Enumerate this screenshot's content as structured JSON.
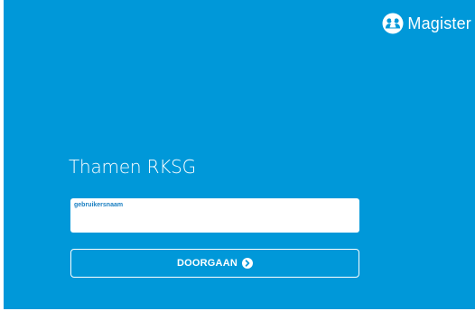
{
  "brand": {
    "name": "Magister",
    "icon": "magister-people-icon"
  },
  "school": {
    "name": "Thamen RKSG"
  },
  "login": {
    "username_label": "gebruikersnaam",
    "username_value": "",
    "continue_label": "DOORGAAN",
    "continue_icon": "circle-arrow-right-icon"
  },
  "colors": {
    "background": "#0098d9",
    "field_label": "#1a7fc2",
    "text": "#ffffff"
  }
}
